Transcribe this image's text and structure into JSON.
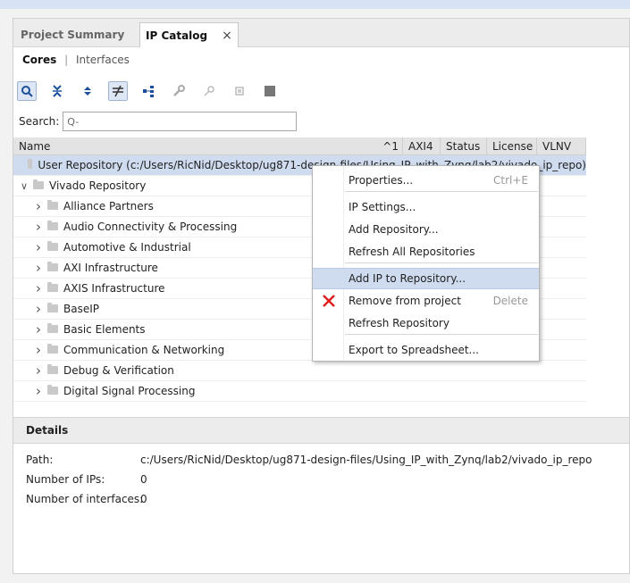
{
  "tabs": [
    {
      "label": "Project Summary",
      "close": "×"
    },
    {
      "label": "IP Catalog",
      "close": "×"
    }
  ],
  "subnav": {
    "cores": "Cores",
    "sep": "|",
    "interfaces": "Interfaces"
  },
  "toolbar_icons": [
    "search-icon",
    "collapse-all-icon",
    "expand-all-icon",
    "filter-icon",
    "hierarchy-icon",
    "wrench-icon",
    "key-icon",
    "chip-icon",
    "stop-icon"
  ],
  "search": {
    "label": "Search:",
    "placeholder": "Q-"
  },
  "table": {
    "columns": [
      "Name",
      "AXI4",
      "Status",
      "License",
      "VLNV"
    ],
    "sort_indicator": "^1",
    "rows": [
      {
        "label": "User Repository (c:/Users/RicNid/Desktop/ug871-design-files/Using_IP_with_Zynq/lab2/vivado_ip_repo)",
        "indent": 0,
        "chevron": ""
      },
      {
        "label": "Vivado Repository",
        "indent": 0,
        "chevron": "v"
      },
      {
        "label": "Alliance Partners",
        "indent": 1,
        "chevron": ">"
      },
      {
        "label": "Audio Connectivity & Processing",
        "indent": 1,
        "chevron": ">"
      },
      {
        "label": "Automotive & Industrial",
        "indent": 1,
        "chevron": ">"
      },
      {
        "label": "AXI Infrastructure",
        "indent": 1,
        "chevron": ">"
      },
      {
        "label": "AXIS Infrastructure",
        "indent": 1,
        "chevron": ">"
      },
      {
        "label": "BaseIP",
        "indent": 1,
        "chevron": ">"
      },
      {
        "label": "Basic Elements",
        "indent": 1,
        "chevron": ">"
      },
      {
        "label": "Communication & Networking",
        "indent": 1,
        "chevron": ">"
      },
      {
        "label": "Debug & Verification",
        "indent": 1,
        "chevron": ">"
      },
      {
        "label": "Digital Signal Processing",
        "indent": 1,
        "chevron": ">"
      }
    ]
  },
  "details": {
    "title": "Details",
    "path_label": "Path:",
    "path_value": "c:/Users/RicNid/Desktop/ug871-design-files/Using_IP_with_Zynq/lab2/vivado_ip_repo",
    "ips_label": "Number of IPs:",
    "ips_value": "0",
    "ifc_label": "Number of interfaces:",
    "ifc_value": "0"
  },
  "context_menu": {
    "items": [
      {
        "label": "Properties...",
        "shortcut": "Ctrl+E"
      },
      {
        "label": "IP Settings...",
        "shortcut": ""
      },
      {
        "label": "Add Repository...",
        "shortcut": ""
      },
      {
        "label": "Refresh All Repositories",
        "shortcut": ""
      },
      {
        "label": "Add IP to Repository...",
        "shortcut": "",
        "highlighted": true
      },
      {
        "label": "Remove from project",
        "shortcut": "Delete",
        "icon": "red-x-icon"
      },
      {
        "label": "Refresh Repository",
        "shortcut": ""
      },
      {
        "label": "Export to Spreadsheet...",
        "shortcut": ""
      }
    ]
  },
  "colors": {
    "selection": "#cfdcef",
    "accent": "#9fb4d4",
    "delete_red": "#e0201f"
  }
}
